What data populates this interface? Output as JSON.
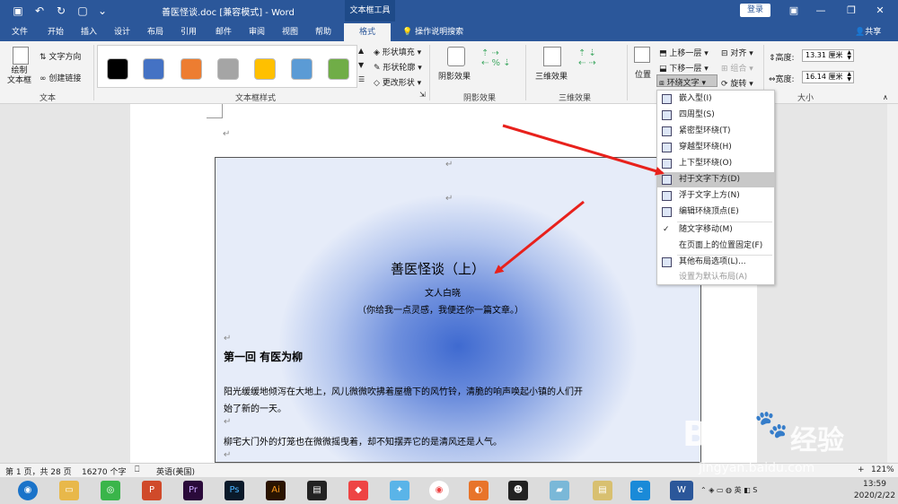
{
  "window": {
    "title": "善医怪谈.doc [兼容模式] - Word",
    "context_tools": "文本框工具",
    "login": "登录"
  },
  "tabs": [
    "文件",
    "开始",
    "插入",
    "设计",
    "布局",
    "引用",
    "邮件",
    "审阅",
    "视图",
    "帮助",
    "格式"
  ],
  "tell_me": "操作说明搜索",
  "share": "共享",
  "ribbon": {
    "text_group": {
      "draw_textbox": "绘制\n文本框",
      "text_direction": "文字方向",
      "create_link": "创建链接",
      "label": "文本"
    },
    "textbox_styles": {
      "swatch_colors": [
        "#000000",
        "#4472c4",
        "#ed7d31",
        "#a5a5a5",
        "#ffc000",
        "#5b9bd5",
        "#70ad47"
      ],
      "shape_fill": "形状填充",
      "shape_outline": "形状轮廓",
      "change_shape": "更改形状",
      "label": "文本框样式"
    },
    "shadow": {
      "button": "阴影效果",
      "label": "阴影效果"
    },
    "three_d": {
      "button": "三维效果",
      "label": "三维效果"
    },
    "arrange": {
      "position": "位置",
      "bring_forward": "上移一层",
      "send_backward": "下移一层",
      "wrap_text": "环绕文字",
      "align": "对齐",
      "group": "组合",
      "rotate": "旋转"
    },
    "size": {
      "height_label": "高度:",
      "height_value": "13.31 厘米",
      "width_label": "宽度:",
      "width_value": "16.14 厘米",
      "label": "大小"
    }
  },
  "wrap_menu": {
    "items": [
      {
        "label": "嵌入型(I)",
        "state": "normal"
      },
      {
        "label": "四周型(S)",
        "state": "normal"
      },
      {
        "label": "紧密型环绕(T)",
        "state": "normal"
      },
      {
        "label": "穿越型环绕(H)",
        "state": "normal"
      },
      {
        "label": "上下型环绕(O)",
        "state": "normal"
      },
      {
        "label": "衬于文字下方(D)",
        "state": "highlighted"
      },
      {
        "label": "浮于文字上方(N)",
        "state": "normal"
      },
      {
        "label": "编辑环绕顶点(E)",
        "state": "normal"
      },
      {
        "label": "随文字移动(M)",
        "state": "checked"
      },
      {
        "label": "在页面上的位置固定(F)",
        "state": "normal"
      },
      {
        "label": "其他布局选项(L)...",
        "state": "normal"
      },
      {
        "label": "设置为默认布局(A)",
        "state": "disabled"
      }
    ]
  },
  "document": {
    "title": "善医怪谈（上）",
    "author": "文人白晓",
    "tagline": "（你给我一点灵感，我便还你一篇文章。）",
    "chapter": "第一回  有医为柳",
    "para1": "阳光缓缓地倾泻在大地上，风儿微微吹拂着屋檐下的风竹铃，清脆的响声唤起小镇的人们开",
    "para1_cont": "始了新的一天。",
    "para2": "柳宅大门外的灯笼也在微微摇曳着，却不知摆弄它的是清风还是人气。",
    "para_mark": "↵"
  },
  "status_bar": {
    "page": "第 1 页，共 28 页",
    "words": "16270 个字",
    "language": "英语(美国)",
    "zoom": "121%"
  },
  "taskbar": {
    "time": "13:59",
    "date": "2020/2/22"
  },
  "watermark": {
    "brand": "Bai",
    "brand_cn": "经验",
    "url": "jingyan.baidu.com"
  }
}
